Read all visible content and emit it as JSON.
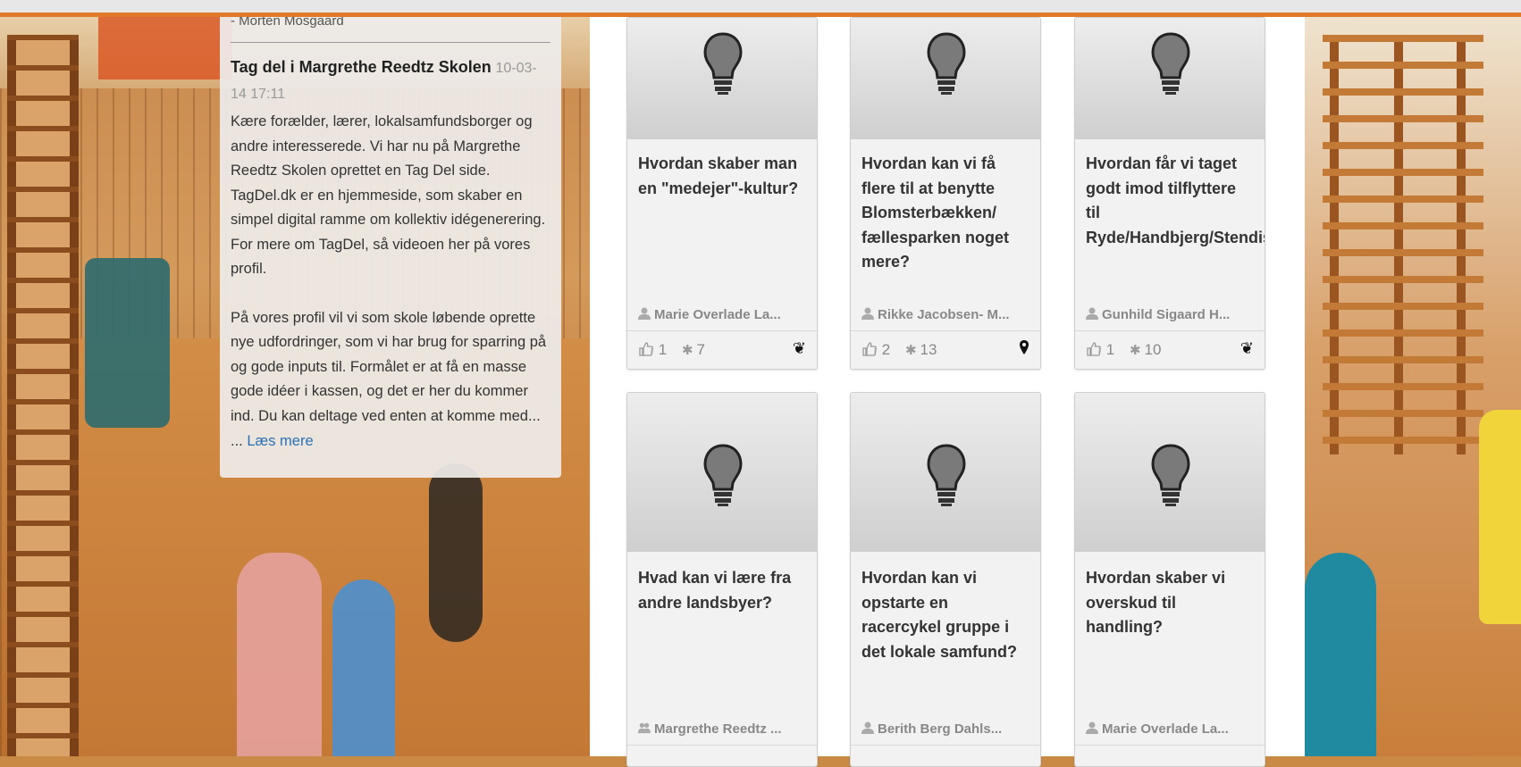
{
  "description": {
    "author": "- Morten Mosgaard",
    "post_title": "Tag del i Margrethe Reedtz Skolen",
    "post_date": "10-03-14 17:11",
    "paragraph1": "Kære forælder, lærer, lokalsamfundsborger og andre interesserede. Vi har nu på Margrethe Reedtz Skolen oprettet en Tag Del side. TagDel.dk er en hjemmeside, som skaber en simpel digital ramme om kollektiv idégenerering. For mere om TagDel, så videoen her på vores profil.",
    "paragraph2": "På vores profil vil vi som skole løbende oprette nye udfordringer, som vi har brug for sparring på og gode inputs til. Formålet er at få en masse gode idéer i kassen, og det er her du kommer ind. Du kan deltage ved enten at komme med...",
    "ellipsis": "...",
    "read_more": "Læs mere"
  },
  "cards": [
    {
      "title": "Hvordan skaber man en \"medejer\"-kultur?",
      "author": "Marie Overlade La...",
      "likes": "1",
      "ideas": "7",
      "category_icon": "tree-icon",
      "category_glyph": "❦"
    },
    {
      "title": "Hvordan kan vi få flere til at benytte Blomsterbækken/ fællesparken noget mere?",
      "author": "Rikke Jacobsen- M...",
      "likes": "2",
      "ideas": "13",
      "category_icon": "map-pin-icon",
      "category_glyph": "⚲"
    },
    {
      "title": "Hvordan får vi taget godt imod tilflyttere til Ryde/Handbjerg/Stendis",
      "author": "Gunhild Sigaard H...",
      "likes": "1",
      "ideas": "10",
      "category_icon": "tree-icon",
      "category_glyph": "❦"
    },
    {
      "title": "Hvad kan vi lære fra andre landsbyer?",
      "author": "Margrethe Reedtz ..."
    },
    {
      "title": "Hvordan kan vi opstarte en racercykel gruppe i det lokale samfund?",
      "author": "Berith Berg Dahls..."
    },
    {
      "title": "Hvordan skaber vi overskud til handling?",
      "author": "Marie Overlade La..."
    }
  ],
  "colors": {
    "accent": "#e07a2a",
    "link": "#2a6fb6"
  }
}
